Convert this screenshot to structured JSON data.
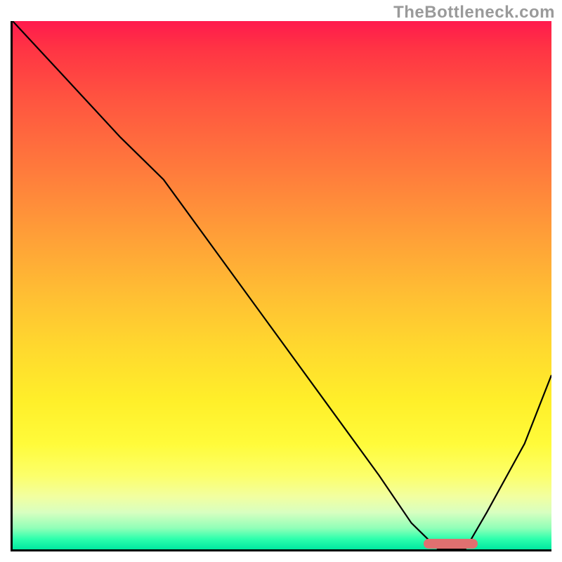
{
  "watermark": "TheBottleneck.com",
  "chart_data": {
    "type": "line",
    "title": "",
    "xlabel": "",
    "ylabel": "",
    "xlim": [
      0,
      100
    ],
    "ylim": [
      0,
      100
    ],
    "grid": false,
    "background": "vertical gradient red→orange→yellow→green",
    "series": [
      {
        "name": "bottleneck-curve",
        "x": [
          0,
          10,
          20,
          28,
          38,
          48,
          58,
          68,
          74,
          79,
          84,
          88,
          95,
          100
        ],
        "values": [
          100,
          89,
          78,
          70,
          56,
          42,
          28,
          14,
          5,
          0,
          0,
          7,
          20,
          33
        ]
      }
    ],
    "marker": {
      "name": "optimal-range",
      "x_start": 76,
      "x_end": 86,
      "color": "#e07070"
    },
    "gradient_stops": [
      {
        "pos": 0,
        "color": "#ff1a4d"
      },
      {
        "pos": 15,
        "color": "#ff5540"
      },
      {
        "pos": 40,
        "color": "#ff9d38"
      },
      {
        "pos": 62,
        "color": "#ffd92e"
      },
      {
        "pos": 86,
        "color": "#fcff6a"
      },
      {
        "pos": 96,
        "color": "#90ffb8"
      },
      {
        "pos": 100,
        "color": "#00e8a0"
      }
    ]
  }
}
